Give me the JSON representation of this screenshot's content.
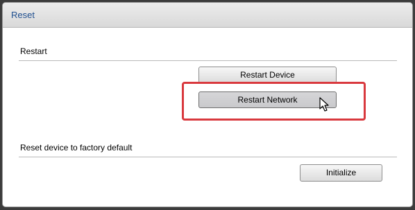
{
  "window": {
    "title": "Reset"
  },
  "restart_section": {
    "label": "Restart",
    "restart_device_label": "Restart Device",
    "restart_network_label": "Restart Network"
  },
  "factory_section": {
    "label": "Reset device to factory default",
    "initialize_label": "Initialize"
  },
  "colors": {
    "title_text": "#1f4f8f",
    "highlight": "#d9393e"
  },
  "icons": {
    "cursor": "mouse-pointer-icon"
  }
}
